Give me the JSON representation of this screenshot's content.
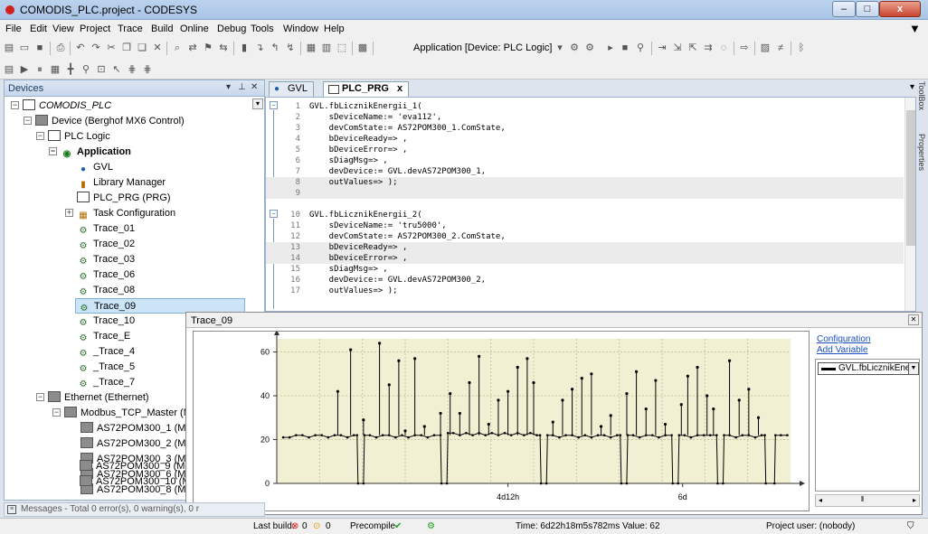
{
  "window": {
    "title": "COMODIS_PLC.project - CODESYS",
    "min_label": "–",
    "max_label": "□",
    "close_label": "x"
  },
  "menu": [
    "File",
    "Edit",
    "View",
    "Project",
    "Trace",
    "Build",
    "Online",
    "Debug",
    "Tools",
    "Window",
    "Help"
  ],
  "toolbar": {
    "application_label": "Application [Device: PLC Logic]"
  },
  "devices": {
    "title": "Devices",
    "tree": [
      {
        "label": "COMODIS_PLC",
        "icon": "project-icon"
      },
      {
        "label": "Device (Berghof MX6 Control)",
        "icon": "device-icon"
      },
      {
        "label": "PLC Logic",
        "icon": "plc-logic-icon"
      },
      {
        "label": "Application",
        "icon": "application-icon"
      },
      {
        "label": "GVL",
        "icon": "gvl-icon"
      },
      {
        "label": "Library Manager",
        "icon": "library-icon"
      },
      {
        "label": "PLC_PRG (PRG)",
        "icon": "program-icon"
      },
      {
        "label": "Task Configuration",
        "icon": "task-icon"
      },
      {
        "label": "Trace_01",
        "icon": "trace-icon"
      },
      {
        "label": "Trace_02",
        "icon": "trace-icon"
      },
      {
        "label": "Trace_03",
        "icon": "trace-icon"
      },
      {
        "label": "Trace_06",
        "icon": "trace-icon"
      },
      {
        "label": "Trace_08",
        "icon": "trace-icon"
      },
      {
        "label": "Trace_09",
        "icon": "trace-icon"
      },
      {
        "label": "Trace_10",
        "icon": "trace-icon"
      },
      {
        "label": "Trace_E",
        "icon": "trace-icon"
      },
      {
        "label": "_Trace_4",
        "icon": "trace-icon"
      },
      {
        "label": "_Trace_5",
        "icon": "trace-icon"
      },
      {
        "label": "_Trace_7",
        "icon": "trace-icon"
      },
      {
        "label": "Ethernet (Ethernet)",
        "icon": "device-icon"
      },
      {
        "label": "Modbus_TCP_Master (Modbus T",
        "icon": "device-icon"
      },
      {
        "label": "AS72POM300_1 (Modbus T",
        "icon": "device-icon"
      },
      {
        "label": "AS72POM300_2 (Modbus T",
        "icon": "device-icon"
      },
      {
        "label": "AS72POM300_3 (Modbus T",
        "icon": "device-icon"
      },
      {
        "label": "AS72POM300_6 (Modbus T",
        "icon": "device-icon"
      },
      {
        "label": "AS72POM300_8 (Modbus T",
        "icon": "device-icon"
      },
      {
        "label": "AS72POM300_9 (Modbus T",
        "icon": "device-icon"
      },
      {
        "label": "AS72POM300_10 (Modbus",
        "icon": "device-icon"
      }
    ]
  },
  "editor": {
    "tabs": [
      "GVL",
      "PLC_PRG"
    ],
    "close_glyph": "x",
    "lines": [
      {
        "n": "1",
        "code": "GVL.fbLicznikEnergii_1("
      },
      {
        "n": "2",
        "code": "    sDeviceName:= 'eva112',"
      },
      {
        "n": "3",
        "code": "    devComState:= AS72POM300_1.ComState,"
      },
      {
        "n": "4",
        "code": "    bDeviceReady=> ,"
      },
      {
        "n": "5",
        "code": "    bDeviceError=> ,"
      },
      {
        "n": "6",
        "code": "    sDiagMsg=> ,"
      },
      {
        "n": "7",
        "code": "    devDevice:= GVL.devAS72POM300_1,"
      },
      {
        "n": "8",
        "code": "    outValues=> );"
      },
      {
        "n": "9",
        "code": ""
      },
      {
        "n": "10",
        "code": "GVL.fbLicznikEnergii_2("
      },
      {
        "n": "11",
        "code": "    sDeviceName:= 'tru5000',"
      },
      {
        "n": "12",
        "code": "    devComState:= AS72POM300_2.ComState,"
      },
      {
        "n": "13",
        "code": "    bDeviceReady=> ,"
      },
      {
        "n": "14",
        "code": "    bDeviceError=> ,"
      },
      {
        "n": "15",
        "code": "    sDiagMsg=> ,"
      },
      {
        "n": "16",
        "code": "    devDevice:= GVL.devAS72POM300_2,"
      },
      {
        "n": "17",
        "code": "    outValues=> );"
      }
    ]
  },
  "toolbox": {
    "toolbox_label": "ToolBox",
    "properties_label": "Properties"
  },
  "trace": {
    "title": "Trace_09",
    "configuration_link": "Configuration",
    "add_variable_link": "Add Variable",
    "variable": "GVL.fbLicznikEnergi",
    "line_color": "#000000",
    "plot_bg": "#f2f0d2"
  },
  "chart_data": {
    "type": "line",
    "title": "",
    "ylim": [
      0,
      66
    ],
    "yticks": [
      0,
      20,
      40,
      60
    ],
    "xticks": [
      "4d12h",
      "6d"
    ],
    "series": [
      {
        "name": "GVL.fbLicznikEnergi",
        "segments": [
          [
            2,
            21
          ],
          [
            4,
            21
          ],
          [
            6,
            22
          ],
          [
            8,
            22
          ],
          [
            10,
            21
          ],
          [
            12,
            22
          ],
          [
            14,
            22
          ],
          [
            16,
            21
          ],
          [
            18,
            22
          ],
          [
            20,
            22
          ],
          [
            22,
            21
          ],
          [
            24,
            22
          ],
          [
            25,
            22
          ],
          [
            25.3,
            0
          ],
          [
            27,
            0
          ],
          [
            27.3,
            22
          ],
          [
            29,
            22
          ],
          [
            31,
            21
          ],
          [
            33,
            22
          ],
          [
            35,
            22
          ],
          [
            37,
            21
          ],
          [
            39,
            22
          ],
          [
            41,
            21
          ],
          [
            43,
            22
          ],
          [
            45,
            22
          ],
          [
            47,
            21
          ],
          [
            49,
            22
          ],
          [
            51,
            22
          ],
          [
            51.3,
            0
          ],
          [
            53,
            0
          ],
          [
            53.3,
            23
          ],
          [
            55,
            23
          ],
          [
            57,
            22
          ],
          [
            59,
            23
          ],
          [
            61,
            22
          ],
          [
            63,
            23
          ],
          [
            65,
            22
          ],
          [
            67,
            23
          ],
          [
            69,
            22
          ],
          [
            71,
            23
          ],
          [
            73,
            22
          ],
          [
            75,
            23
          ],
          [
            77,
            22
          ],
          [
            79,
            23
          ],
          [
            81,
            22
          ],
          [
            82,
            22
          ],
          [
            82.3,
            0
          ],
          [
            84,
            0
          ],
          [
            84.3,
            22
          ],
          [
            86,
            22
          ],
          [
            88,
            21
          ],
          [
            90,
            22
          ],
          [
            92,
            22
          ],
          [
            94,
            21
          ],
          [
            96,
            22
          ],
          [
            98,
            21
          ],
          [
            100,
            22
          ],
          [
            102,
            22
          ],
          [
            104,
            21
          ],
          [
            106,
            22
          ],
          [
            107,
            22
          ],
          [
            107.3,
            0
          ],
          [
            109,
            0
          ],
          [
            109.3,
            22
          ],
          [
            111,
            22
          ],
          [
            113,
            21
          ],
          [
            115,
            22
          ],
          [
            117,
            22
          ],
          [
            119,
            21
          ],
          [
            121,
            22
          ],
          [
            123,
            22
          ],
          [
            123.3,
            0
          ],
          [
            125,
            0
          ],
          [
            125.3,
            22
          ],
          [
            127,
            22
          ],
          [
            129,
            21
          ],
          [
            131,
            22
          ],
          [
            133,
            22
          ],
          [
            135,
            22
          ],
          [
            137,
            22
          ],
          [
            137.3,
            0
          ],
          [
            139,
            0
          ],
          [
            139.3,
            22
          ],
          [
            141,
            22
          ],
          [
            143,
            21
          ],
          [
            145,
            22
          ],
          [
            147,
            22
          ],
          [
            149,
            21
          ],
          [
            151,
            22
          ],
          [
            152,
            22
          ],
          [
            152.3,
            0
          ],
          [
            155,
            0
          ],
          [
            155.3,
            22
          ],
          [
            157,
            22
          ],
          [
            159,
            22
          ]
        ],
        "spikes": [
          [
            19,
            42
          ],
          [
            23,
            61
          ],
          [
            27,
            29
          ],
          [
            32,
            64
          ],
          [
            35,
            45
          ],
          [
            38,
            56
          ],
          [
            40,
            24
          ],
          [
            43,
            57
          ],
          [
            46,
            26
          ],
          [
            51,
            32
          ],
          [
            54,
            41
          ],
          [
            57,
            32
          ],
          [
            60,
            46
          ],
          [
            63,
            58
          ],
          [
            66,
            27
          ],
          [
            69,
            38
          ],
          [
            72,
            42
          ],
          [
            75,
            53
          ],
          [
            78,
            57
          ],
          [
            80,
            46
          ],
          [
            86,
            28
          ],
          [
            89,
            38
          ],
          [
            92,
            43
          ],
          [
            95,
            48
          ],
          [
            98,
            50
          ],
          [
            101,
            26
          ],
          [
            104,
            31
          ],
          [
            109,
            41
          ],
          [
            112,
            51
          ],
          [
            115,
            34
          ],
          [
            118,
            47
          ],
          [
            121,
            27
          ],
          [
            126,
            36
          ],
          [
            128,
            49
          ],
          [
            131,
            53
          ],
          [
            134,
            40
          ],
          [
            136,
            34
          ],
          [
            141,
            56
          ],
          [
            144,
            38
          ],
          [
            147,
            43
          ],
          [
            150,
            30
          ]
        ]
      }
    ],
    "xlim": [
      0,
      160
    ]
  },
  "messages": {
    "text": "Messages - Total 0 error(s), 0 warning(s), 0 r"
  },
  "status": {
    "last_build_label": "Last build:",
    "errors": "0",
    "warnings": "0",
    "precompile": "Precompile",
    "time_value": "Time: 6d22h18m5s782ms  Value: 62",
    "project_user": "Project user: (nobody)"
  },
  "colors": {
    "accent": "#1a4fc0",
    "selected": "#cce4f7",
    "plot_bg": "#f2f0d2"
  }
}
